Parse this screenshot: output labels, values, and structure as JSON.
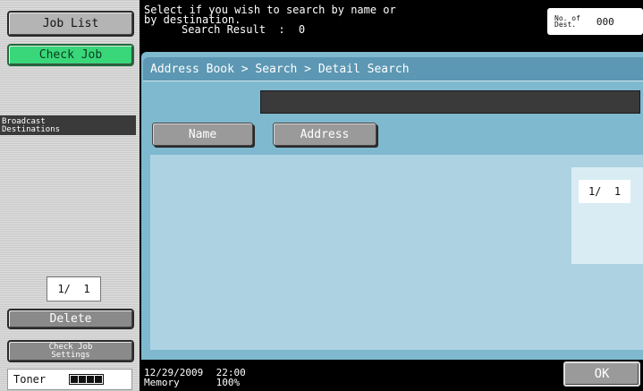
{
  "sidebar": {
    "job_list_label": "Job List",
    "check_job_label": "Check Job",
    "broadcast_label": "Broadcast\nDestinations",
    "page_indicator": "1/  1",
    "delete_label": "Delete",
    "check_job_settings_label": "Check Job\nSettings",
    "toner_label": "Toner",
    "toner_level": 1.0
  },
  "header": {
    "message_line1": "Select if you wish to search by name or",
    "message_line2": "by destination.",
    "search_result_label": "Search Result  :",
    "search_result_value": "0",
    "dest_label": "No. of\nDest.",
    "dest_value": "000"
  },
  "main": {
    "breadcrumb": "Address Book > Search > Detail Search",
    "search_value": "",
    "tabs": [
      {
        "label": "Name"
      },
      {
        "label": "Address"
      }
    ],
    "page_indicator": "1/  1"
  },
  "footer": {
    "date": "12/29/2009",
    "time": "22:00",
    "memory_label": "Memory",
    "memory_value": "100%",
    "ok_label": "OK"
  },
  "colors": {
    "accent_green": "#39d77a",
    "panel_blue": "#7fb9cf",
    "header_blue": "#5c97b3"
  }
}
